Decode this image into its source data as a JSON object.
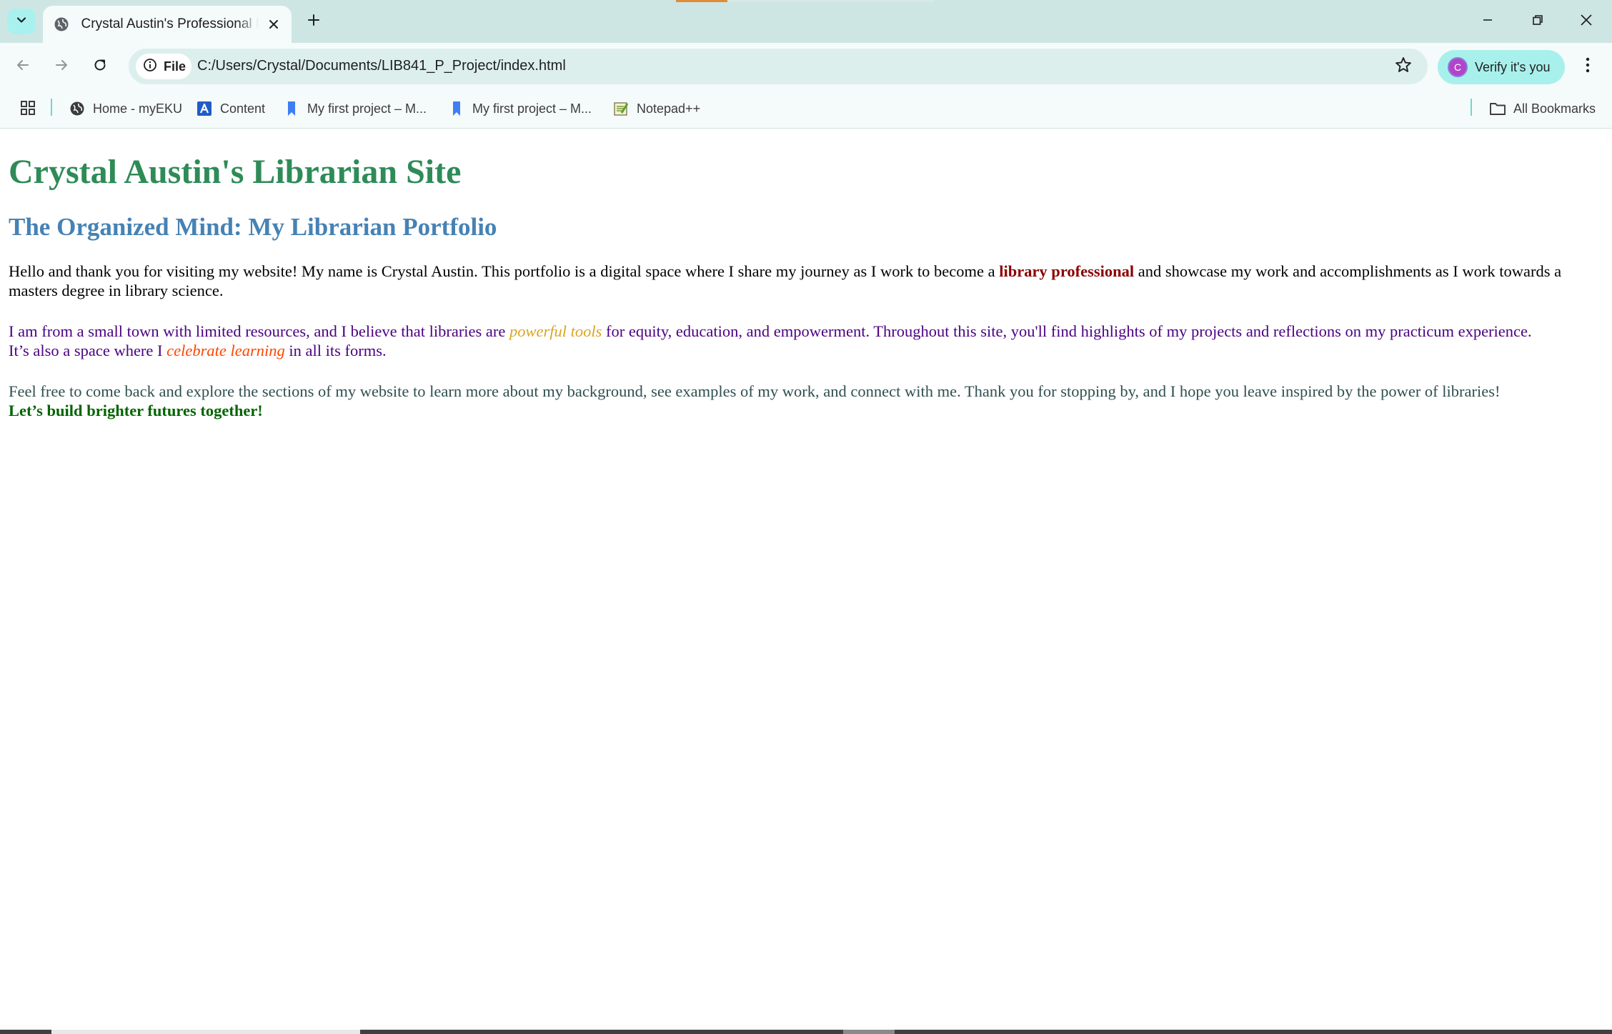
{
  "browser": {
    "tab": {
      "title": "Crystal Austin's Professional Portfolio"
    },
    "address_bar": {
      "chip_label": "File",
      "url": "C:/Users/Crystal/Documents/LIB841_P_Project/index.html"
    },
    "profile": {
      "avatar_letter": "C",
      "verify_label": "Verify it's you"
    },
    "bookmarks": {
      "items": [
        {
          "label": "Home - myEKU",
          "icon": "globe-icon"
        },
        {
          "label": "Content",
          "icon": "content-app-icon"
        },
        {
          "label": "My first project – M...",
          "icon": "bookmark-icon"
        },
        {
          "label": "My first project – M...",
          "icon": "bookmark-icon"
        },
        {
          "label": "Notepad++",
          "icon": "notepad-icon"
        }
      ],
      "all_bookmarks_label": "All Bookmarks"
    }
  },
  "page": {
    "title": "Crystal Austin's Librarian Site",
    "subtitle": "The Organized Mind: My Librarian Portfolio",
    "intro": {
      "before": "Hello and thank you for visiting my website! My name is Crystal Austin. This portfolio is a digital space where I share my journey as I work to become a ",
      "highlight": "library professional",
      "after": " and showcase my work and accomplishments as I work towards a masters degree in library science."
    },
    "mission": {
      "before": "I am from a small town with limited resources, and I believe that libraries are ",
      "highlight1": "powerful tools",
      "middle": " for equity, education, and empowerment. Throughout this site, you'll find highlights of my projects and reflections on my practicum experience.",
      "line2_before": "It’s also a space where I ",
      "highlight2": "celebrate learning",
      "line2_after": " in all its forms."
    },
    "closing": {
      "text": "Feel free to come back and explore the sections of my website to learn more about my background, see examples of my work, and connect with me. Thank you for stopping by, and I hope you leave inspired by the power of libraries!",
      "emphasis": "Let’s build brighter futures together!"
    }
  },
  "colors": {
    "title": "#2e8b57",
    "subtitle": "#4682b4",
    "intro_highlight": "#8b0000",
    "mission_text": "#4b0082",
    "mission_highlight1": "#daa520",
    "mission_highlight2": "#ff4500",
    "closing_text": "#2f4f4f",
    "closing_emphasis": "#006400"
  }
}
